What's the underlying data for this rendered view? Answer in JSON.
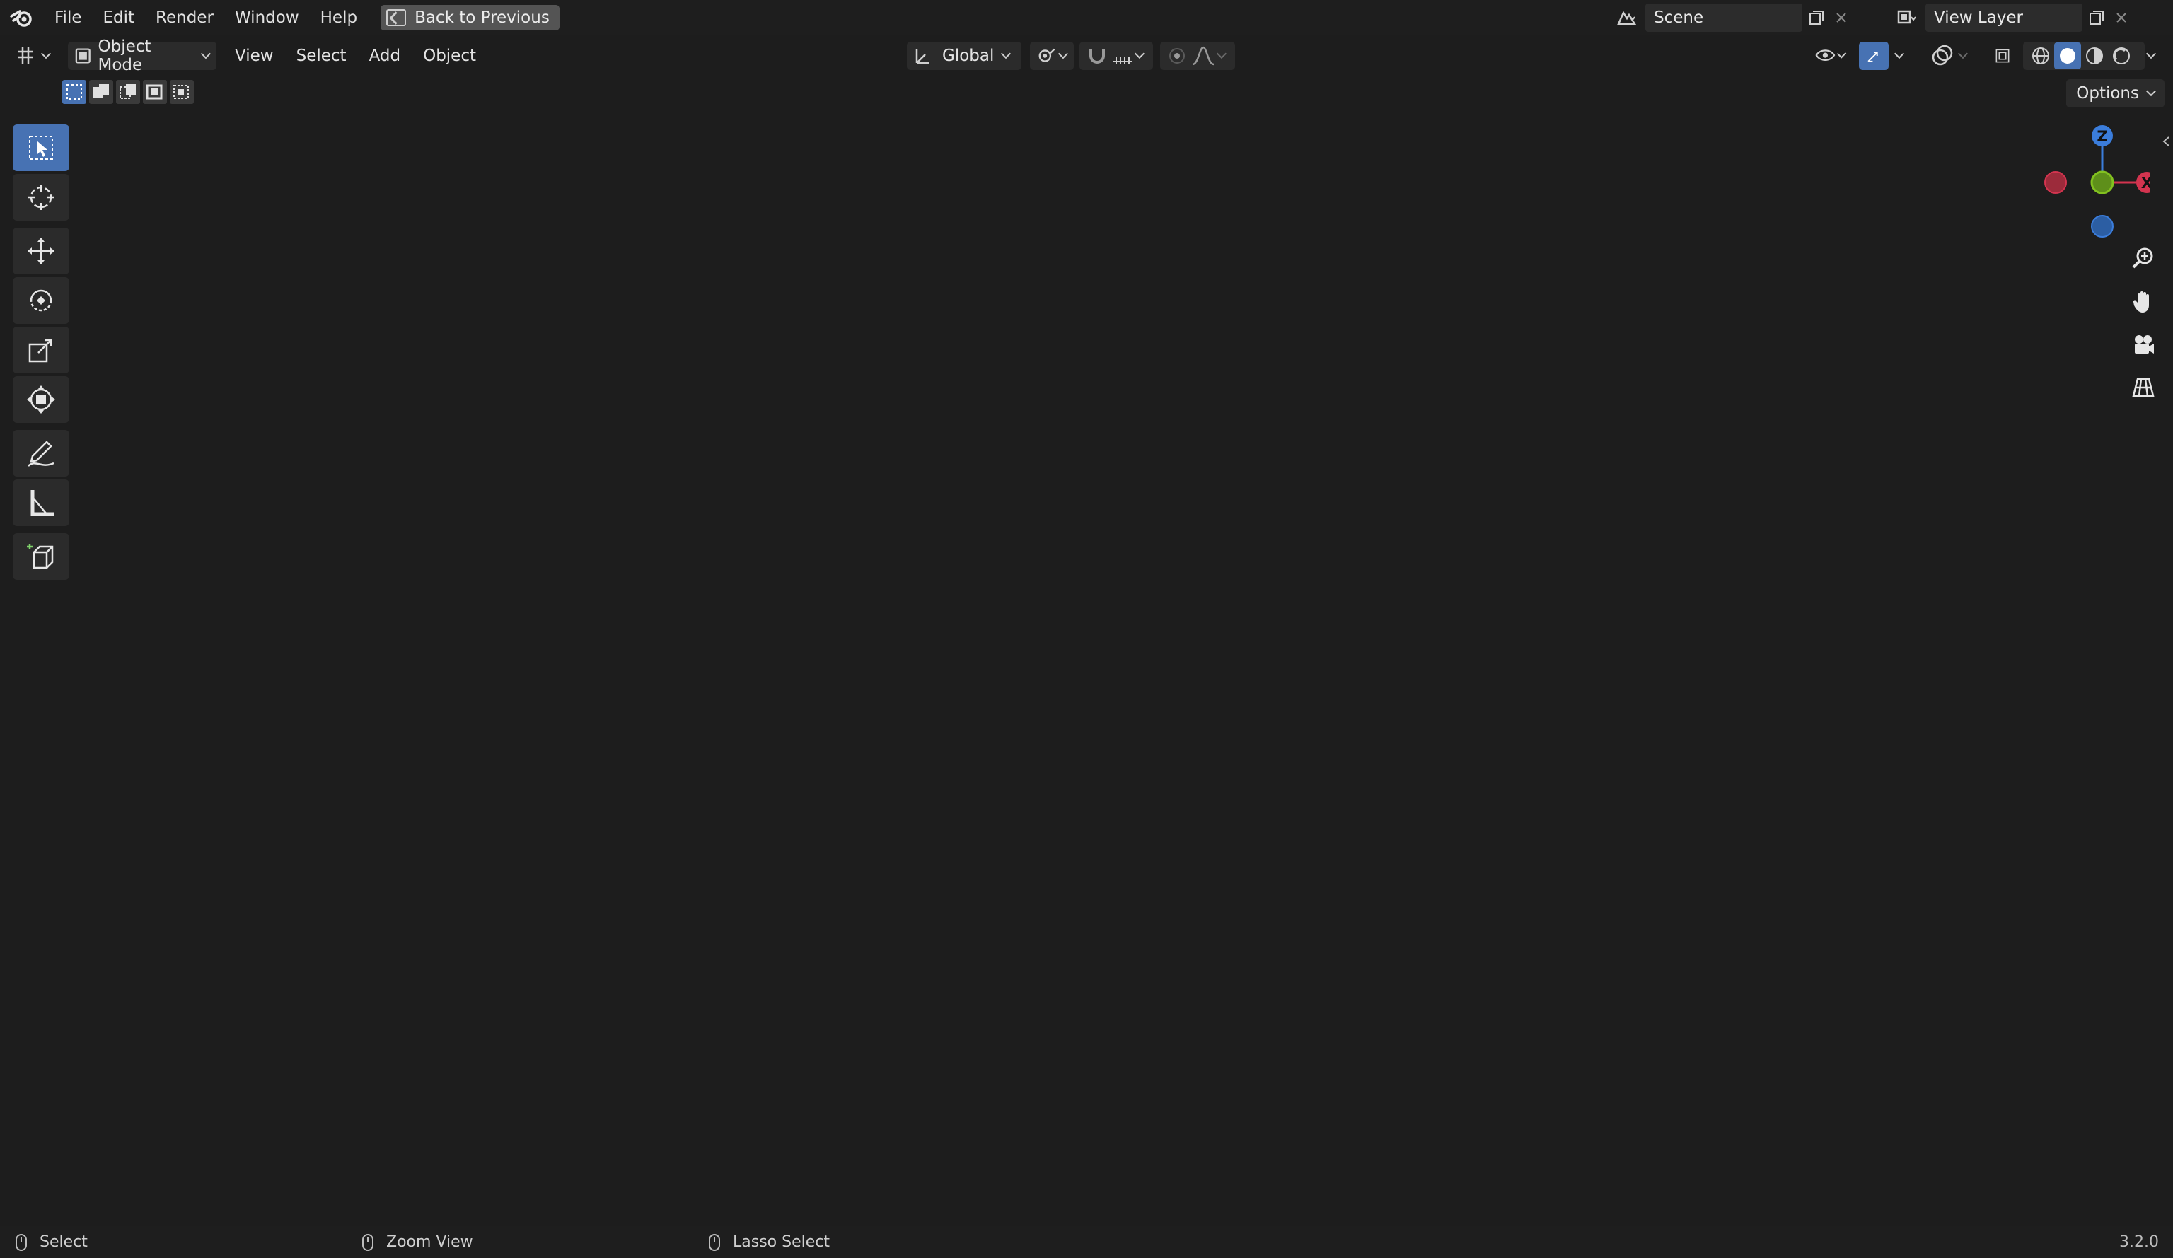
{
  "menu": {
    "file": "File",
    "edit": "Edit",
    "render": "Render",
    "window": "Window",
    "help": "Help",
    "back_button": "Back to Previous"
  },
  "workspace": {
    "scene_label": "Scene",
    "view_layer_label": "View Layer"
  },
  "viewport_header": {
    "mode": "Object Mode",
    "view": "View",
    "select": "Select",
    "add": "Add",
    "object": "Object",
    "transform_orientation": "Global",
    "options": "Options"
  },
  "gizmo": {
    "z_label": "Z",
    "x_label": "X"
  },
  "toolbar": {
    "tools": [
      "select-box",
      "cursor",
      "move",
      "rotate",
      "scale",
      "transform",
      "annotate",
      "measure",
      "add-cube"
    ]
  },
  "status_bar": {
    "left_action": "Select",
    "middle_action": "Zoom View",
    "right_action": "Lasso Select",
    "version": "3.2.0"
  },
  "colors": {
    "accent": "#4772b3",
    "axis_x": "#d3344f",
    "axis_y": "#82c11f",
    "axis_z": "#3b7ddb"
  }
}
